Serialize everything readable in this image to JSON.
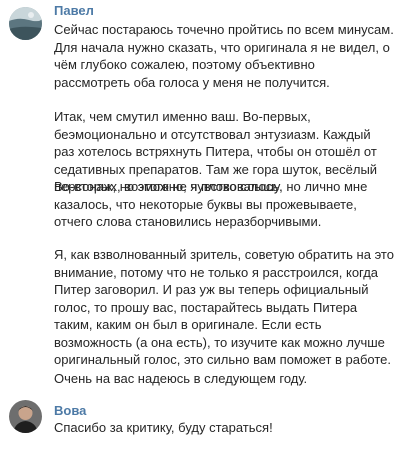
{
  "messages": [
    {
      "author": "Павел",
      "avatar": "avatar-photo-pavel",
      "paragraphs": [
        "Сейчас постараюсь точечно пройтись по всем минусам. Для начала нужно сказать, что оригинала я не видел, о чём глубоко сожалею, поэтому объективно рассмотреть оба голоса у меня не получится.",
        "Итак, чем смутил именно ваш. Во-первых, беэмоционально и отсутствовал энтузиазм. Каждый раз хотелось встряхнуть Питера, чтобы он отошёл от седативных препаратов. Там же гора шуток, весёлый персонаж, но этого не чувствовалось.",
        "Во-вторых, возможно, я плохо слышу, но лично мне казалось, что некоторые буквы вы прожевываете, отчего слова становились неразборчивыми.",
        "Я, как взволнованный зритель, советую обратить на это внимание, потому что не только я расстроился, когда Питер заговорил. И раз уж вы теперь официальный голос, то прошу вас, постарайтесь выдать Питера таким, каким он был в оригинале. Если есть возможность (а она есть), то изучите как можно лучше оригинальный голос, это сильно вам поможет в работе.",
        "Очень на вас надеюсь в следующем году."
      ]
    },
    {
      "author": "Вова",
      "avatar": "avatar-photo-vova",
      "paragraphs": [
        "Спасибо за критику, буду стараться!"
      ]
    }
  ],
  "colors": {
    "author_name": "#4d7aa6",
    "message_text": "#262626",
    "background": "#ffffff"
  }
}
